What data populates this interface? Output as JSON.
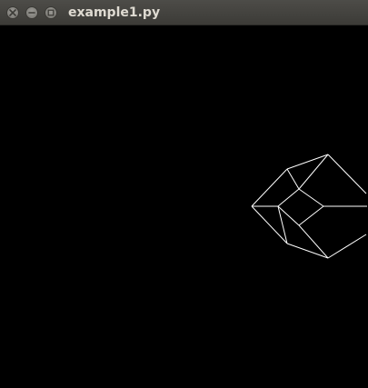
{
  "window": {
    "title": "example1.py",
    "buttons": {
      "close": "close-icon",
      "minimize": "minimize-icon",
      "maximize": "maximize-icon"
    }
  },
  "canvas": {
    "background": "#000000",
    "shape": "wireframe-cube",
    "line_color": "#ffffff"
  }
}
